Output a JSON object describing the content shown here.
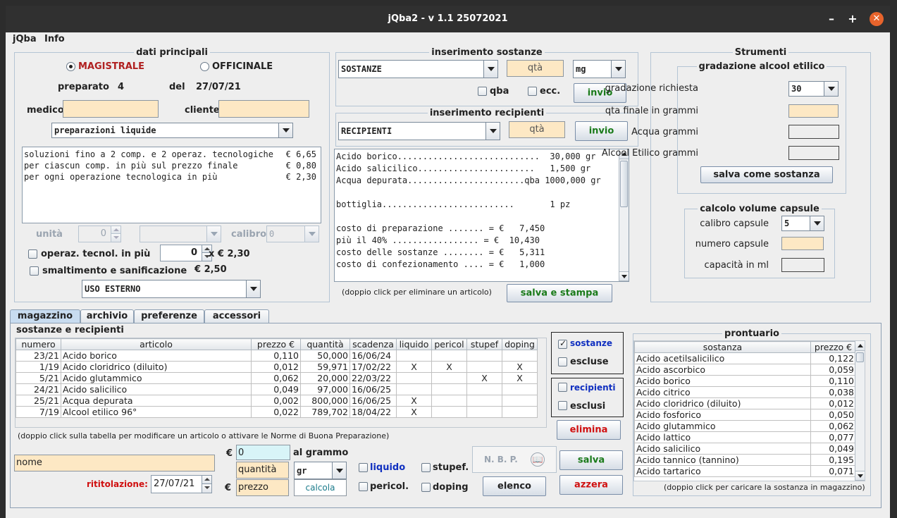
{
  "window": {
    "title": "jQba2 - v 1.1 25072021",
    "minimize": "–",
    "maximize": "+",
    "close": "✕"
  },
  "menu": {
    "items": [
      "jQba",
      "Info"
    ]
  },
  "dati_principali": {
    "legend": "dati principali",
    "radio_magistrale": "MAGISTRALE",
    "radio_officinale": "OFFICINALE",
    "preparato_label": "preparato",
    "preparato_value": "4",
    "del_label": "del",
    "del_value": "27/07/21",
    "medico_label": "medico",
    "medico_value": "",
    "cliente_label": "cliente",
    "cliente_value": "",
    "tipo_combo": "preparazioni liquide",
    "tariffe": [
      {
        "desc": "soluzioni fino a 2 comp. e 2 operaz. tecnologiche",
        "price": "€ 6,65"
      },
      {
        "desc": "per ciascun comp. in più sul prezzo finale",
        "price": "€ 0,80"
      },
      {
        "desc": "per ogni operazione tecnologica in più",
        "price": "€ 2,30"
      }
    ],
    "unita_label": "unità",
    "unita_value": "0",
    "calibro_label": "calibro:",
    "calibro_value": "0",
    "operaz_label": "operaz. tecnol. in più",
    "operaz_value": "0",
    "operaz_price": "x  € 2,30",
    "smaltimento_label": "smaltimento e sanificazione",
    "smaltimento_price": "€ 2,50",
    "uso_combo": "USO ESTERNO"
  },
  "inserimento_sostanze": {
    "legend": "inserimento sostanze",
    "combo": "SOSTANZE",
    "qta": "qtà",
    "unit_combo": "mg",
    "qba_label": "qba",
    "ecc_label": "ecc.",
    "invio": "invio"
  },
  "inserimento_recipienti": {
    "legend": "inserimento recipienti",
    "combo": "RECIPIENTI",
    "qta": "qtà",
    "invio": "invio"
  },
  "ricetta": {
    "lines": [
      "Acido borico............................  30,000 gr",
      "Acido salicilico.......................   1,500 gr",
      "Acqua depurata.......................qba 1000,000 gr",
      "",
      "bottiglia..........................       1 pz",
      "",
      "costo di preparazione ....... = €   7,450",
      "più il 40% ................. = €  10,430",
      "costo delle sostanze ........ = €   5,311",
      "costo di confezionamento .... = €   1,000"
    ],
    "note": "(doppio click per eliminare un articolo)",
    "salva_stampa": "salva e stampa"
  },
  "strumenti": {
    "legend": "Strumenti",
    "alcool_legend": "gradazione alcool etilico",
    "gradazione_label": "gradazione richiesta",
    "gradazione_value": "30",
    "qta_finale_label": "qta finale in grammi",
    "acqua_label": "Acqua grammi",
    "alcool_label": "Alcool Etilico grammi",
    "salva_sostanza": "salva come sostanza",
    "capsule_legend": "calcolo volume capsule",
    "calibro_label": "calibro capsule",
    "calibro_value": "5",
    "numero_label": "numero capsule",
    "capacita_label": "capacità in ml"
  },
  "tabs": [
    "magazzino",
    "archivio",
    "preferenze",
    "accessori"
  ],
  "magazzino": {
    "legend": "sostanze e recipienti",
    "columns": [
      "numero",
      "articolo",
      "prezzo €",
      "quantità",
      "scadenza",
      "liquido",
      "pericol",
      "stupef",
      "doping"
    ],
    "rows": [
      [
        "23/21",
        "Acido borico",
        "0,110",
        "50,000",
        "16/06/24",
        "",
        "",
        "",
        ""
      ],
      [
        "1/19",
        "Acido cloridrico (diluito)",
        "0,012",
        "59,971",
        "17/02/22",
        "X",
        "X",
        "",
        "X"
      ],
      [
        "5/21",
        "Acido glutammico",
        "0,062",
        "20,000",
        "22/03/22",
        "",
        "",
        "X",
        "X"
      ],
      [
        "24/21",
        "Acido salicilico",
        "0,049",
        "97,000",
        "16/06/25",
        "",
        "",
        "",
        ""
      ],
      [
        "25/21",
        "Acqua depurata",
        "0,002",
        "800,000",
        "16/06/25",
        "X",
        "",
        "",
        ""
      ],
      [
        "7/19",
        "Alcool etilico 96°",
        "0,022",
        "789,702",
        "18/04/22",
        "X",
        "",
        "",
        ""
      ]
    ],
    "note": "(doppio click sulla tabella per modificare un articolo o attivare le Norme di Buona Preparazione)",
    "filter_sostanze": "sostanze",
    "filter_escluse": "escluse",
    "filter_recipienti": "recipienti",
    "filter_esclusi": "esclusi",
    "elimina": "elimina",
    "euro1": "€",
    "euro2": "€",
    "nome_value": "nome",
    "codice_value": "0",
    "al_grammo": "al grammo",
    "quantita_value": "quantità",
    "prezzo_value": "prezzo",
    "unit_combo": "gr",
    "calcola": "calcola",
    "liquido": "liquido",
    "pericol": "pericol.",
    "stupef": "stupef.",
    "doping": "doping",
    "nbp": "N. B. P.",
    "elenco": "elenco",
    "salva": "salva",
    "azzera": "azzera",
    "rititolazione_label": "rititolazione:",
    "rititolazione_value": "27/07/21"
  },
  "prontuario": {
    "legend": "prontuario",
    "columns": [
      "sostanza",
      "prezzo €"
    ],
    "rows": [
      [
        "Acido acetilsalicilico",
        "0,122"
      ],
      [
        "Acido ascorbico",
        "0,059"
      ],
      [
        "Acido borico",
        "0,110"
      ],
      [
        "Acido citrico",
        "0,038"
      ],
      [
        "Acido cloridrico (diluito)",
        "0,012"
      ],
      [
        "Acido fosforico",
        "0,050"
      ],
      [
        "Acido glutammico",
        "0,062"
      ],
      [
        "Acido lattico",
        "0,077"
      ],
      [
        "Acido salicilico",
        "0,049"
      ],
      [
        "Acido tannico (tannino)",
        "0,195"
      ],
      [
        "Acido tartarico",
        "0,071"
      ]
    ],
    "note": "(doppio click per caricare la sostanza in magazzino)"
  },
  "colors": {
    "accent_red": "#d01010",
    "accent_green": "#1a7a1a",
    "accent_blue": "#1030c0",
    "field_orange": "#fde8c4",
    "close_orange": "#e8642c"
  }
}
